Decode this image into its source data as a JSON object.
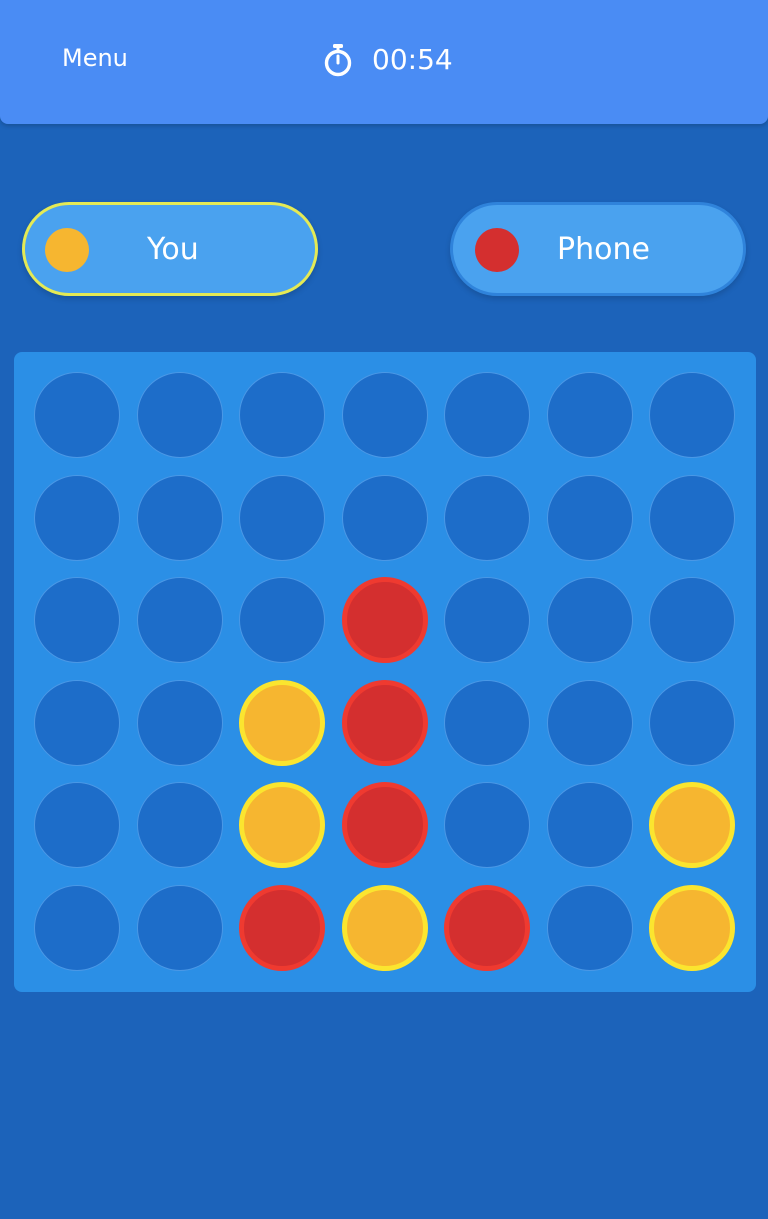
{
  "header": {
    "menu_label": "Menu",
    "timer_icon": "stopwatch-icon",
    "timer": "00:54"
  },
  "players": [
    {
      "name": "You",
      "color": "#f6b630",
      "token": "yellow-token",
      "active": true
    },
    {
      "name": "Phone",
      "color": "#d42f2f",
      "token": "red-token",
      "active": false
    }
  ],
  "board": {
    "columns": 7,
    "rows": 6,
    "colors": {
      "empty": "#1d6dc9",
      "red": "#d42f2f",
      "yellow": "#f6b630"
    },
    "grid": [
      [
        "empty",
        "empty",
        "empty",
        "empty",
        "empty",
        "empty",
        "empty"
      ],
      [
        "empty",
        "empty",
        "empty",
        "empty",
        "empty",
        "empty",
        "empty"
      ],
      [
        "empty",
        "empty",
        "empty",
        "red",
        "empty",
        "empty",
        "empty"
      ],
      [
        "empty",
        "empty",
        "yellow",
        "red",
        "empty",
        "empty",
        "empty"
      ],
      [
        "empty",
        "empty",
        "yellow",
        "red",
        "empty",
        "empty",
        "yellow"
      ],
      [
        "empty",
        "empty",
        "red",
        "yellow",
        "red",
        "empty",
        "yellow"
      ]
    ]
  }
}
